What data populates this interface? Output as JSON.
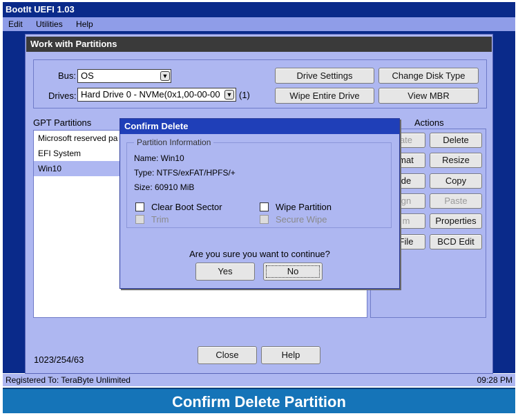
{
  "window": {
    "title": "BootIt UEFI 1.03"
  },
  "menu": {
    "items": [
      "Edit",
      "Utilities",
      "Help"
    ]
  },
  "panel": {
    "title": "Work with Partitions"
  },
  "bus": {
    "label": "Bus:",
    "value": "OS"
  },
  "drives": {
    "label": "Drives:",
    "value": "Hard Drive 0 - NVMe(0x1,00-00-00",
    "suffix": "(1)"
  },
  "top_buttons": {
    "drive_settings": "Drive Settings",
    "change_disk_type": "Change Disk Type",
    "wipe_entire_drive": "Wipe Entire Drive",
    "view_mbr": "View MBR"
  },
  "partitions": {
    "label": "GPT Partitions",
    "items": [
      "Microsoft reserved pa",
      "EFI System",
      "Win10"
    ],
    "selected_index": 2
  },
  "actions": {
    "label": "Actions",
    "left_buttons": [
      {
        "label": "ate",
        "disabled": true
      },
      {
        "label": "mat",
        "disabled": false
      },
      {
        "label": "de",
        "disabled": false
      },
      {
        "label": "gn",
        "disabled": true
      },
      {
        "label": "m",
        "disabled": true
      },
      {
        "label": "File",
        "disabled": false
      }
    ],
    "right_buttons": [
      {
        "label": "Delete",
        "disabled": false
      },
      {
        "label": "Resize",
        "disabled": false
      },
      {
        "label": "Copy",
        "disabled": false
      },
      {
        "label": "Paste",
        "disabled": true
      },
      {
        "label": "Properties",
        "disabled": false
      },
      {
        "label": "BCD Edit",
        "disabled": false
      }
    ]
  },
  "geometry_text": "1023/254/63",
  "bottom_buttons": {
    "close": "Close",
    "help": "Help"
  },
  "dialog": {
    "title": "Confirm Delete",
    "group_title": "Partition Information",
    "name": "Name: Win10",
    "type": "Type: NTFS/exFAT/HPFS/+",
    "size": "Size: 60910 MiB",
    "options": {
      "clear_boot_sector": "Clear Boot Sector",
      "wipe_partition": "Wipe Partition",
      "trim": "Trim",
      "secure_wipe": "Secure Wipe"
    },
    "question": "Are you sure you want to continue?",
    "yes": "Yes",
    "no": "No"
  },
  "status": {
    "registered": "Registered To: TeraByte Unlimited",
    "time": "09:28 PM"
  },
  "banner": {
    "text": "Confirm Delete Partition"
  }
}
